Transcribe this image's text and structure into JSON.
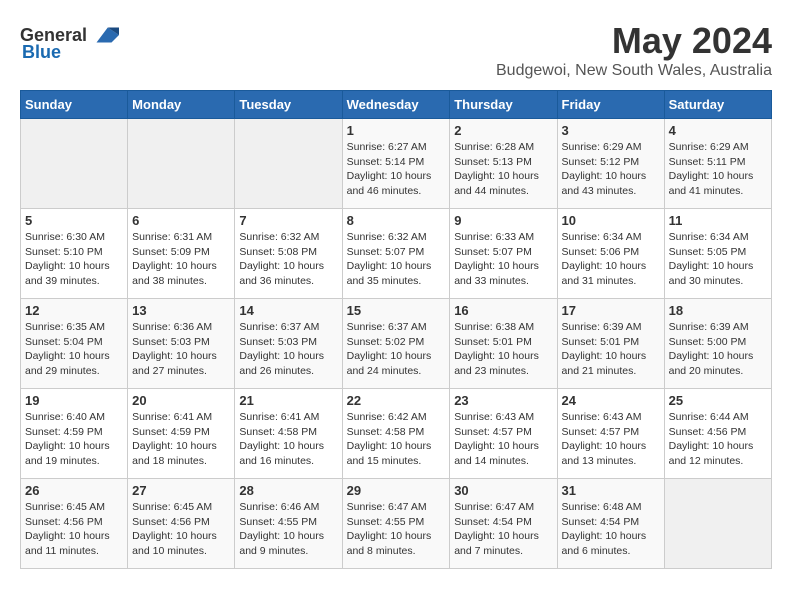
{
  "header": {
    "logo_general": "General",
    "logo_blue": "Blue",
    "month": "May 2024",
    "location": "Budgewoi, New South Wales, Australia"
  },
  "days_of_week": [
    "Sunday",
    "Monday",
    "Tuesday",
    "Wednesday",
    "Thursday",
    "Friday",
    "Saturday"
  ],
  "weeks": [
    [
      {
        "day": "",
        "info": ""
      },
      {
        "day": "",
        "info": ""
      },
      {
        "day": "",
        "info": ""
      },
      {
        "day": "1",
        "info": "Sunrise: 6:27 AM\nSunset: 5:14 PM\nDaylight: 10 hours and 46 minutes."
      },
      {
        "day": "2",
        "info": "Sunrise: 6:28 AM\nSunset: 5:13 PM\nDaylight: 10 hours and 44 minutes."
      },
      {
        "day": "3",
        "info": "Sunrise: 6:29 AM\nSunset: 5:12 PM\nDaylight: 10 hours and 43 minutes."
      },
      {
        "day": "4",
        "info": "Sunrise: 6:29 AM\nSunset: 5:11 PM\nDaylight: 10 hours and 41 minutes."
      }
    ],
    [
      {
        "day": "5",
        "info": "Sunrise: 6:30 AM\nSunset: 5:10 PM\nDaylight: 10 hours and 39 minutes."
      },
      {
        "day": "6",
        "info": "Sunrise: 6:31 AM\nSunset: 5:09 PM\nDaylight: 10 hours and 38 minutes."
      },
      {
        "day": "7",
        "info": "Sunrise: 6:32 AM\nSunset: 5:08 PM\nDaylight: 10 hours and 36 minutes."
      },
      {
        "day": "8",
        "info": "Sunrise: 6:32 AM\nSunset: 5:07 PM\nDaylight: 10 hours and 35 minutes."
      },
      {
        "day": "9",
        "info": "Sunrise: 6:33 AM\nSunset: 5:07 PM\nDaylight: 10 hours and 33 minutes."
      },
      {
        "day": "10",
        "info": "Sunrise: 6:34 AM\nSunset: 5:06 PM\nDaylight: 10 hours and 31 minutes."
      },
      {
        "day": "11",
        "info": "Sunrise: 6:34 AM\nSunset: 5:05 PM\nDaylight: 10 hours and 30 minutes."
      }
    ],
    [
      {
        "day": "12",
        "info": "Sunrise: 6:35 AM\nSunset: 5:04 PM\nDaylight: 10 hours and 29 minutes."
      },
      {
        "day": "13",
        "info": "Sunrise: 6:36 AM\nSunset: 5:03 PM\nDaylight: 10 hours and 27 minutes."
      },
      {
        "day": "14",
        "info": "Sunrise: 6:37 AM\nSunset: 5:03 PM\nDaylight: 10 hours and 26 minutes."
      },
      {
        "day": "15",
        "info": "Sunrise: 6:37 AM\nSunset: 5:02 PM\nDaylight: 10 hours and 24 minutes."
      },
      {
        "day": "16",
        "info": "Sunrise: 6:38 AM\nSunset: 5:01 PM\nDaylight: 10 hours and 23 minutes."
      },
      {
        "day": "17",
        "info": "Sunrise: 6:39 AM\nSunset: 5:01 PM\nDaylight: 10 hours and 21 minutes."
      },
      {
        "day": "18",
        "info": "Sunrise: 6:39 AM\nSunset: 5:00 PM\nDaylight: 10 hours and 20 minutes."
      }
    ],
    [
      {
        "day": "19",
        "info": "Sunrise: 6:40 AM\nSunset: 4:59 PM\nDaylight: 10 hours and 19 minutes."
      },
      {
        "day": "20",
        "info": "Sunrise: 6:41 AM\nSunset: 4:59 PM\nDaylight: 10 hours and 18 minutes."
      },
      {
        "day": "21",
        "info": "Sunrise: 6:41 AM\nSunset: 4:58 PM\nDaylight: 10 hours and 16 minutes."
      },
      {
        "day": "22",
        "info": "Sunrise: 6:42 AM\nSunset: 4:58 PM\nDaylight: 10 hours and 15 minutes."
      },
      {
        "day": "23",
        "info": "Sunrise: 6:43 AM\nSunset: 4:57 PM\nDaylight: 10 hours and 14 minutes."
      },
      {
        "day": "24",
        "info": "Sunrise: 6:43 AM\nSunset: 4:57 PM\nDaylight: 10 hours and 13 minutes."
      },
      {
        "day": "25",
        "info": "Sunrise: 6:44 AM\nSunset: 4:56 PM\nDaylight: 10 hours and 12 minutes."
      }
    ],
    [
      {
        "day": "26",
        "info": "Sunrise: 6:45 AM\nSunset: 4:56 PM\nDaylight: 10 hours and 11 minutes."
      },
      {
        "day": "27",
        "info": "Sunrise: 6:45 AM\nSunset: 4:56 PM\nDaylight: 10 hours and 10 minutes."
      },
      {
        "day": "28",
        "info": "Sunrise: 6:46 AM\nSunset: 4:55 PM\nDaylight: 10 hours and 9 minutes."
      },
      {
        "day": "29",
        "info": "Sunrise: 6:47 AM\nSunset: 4:55 PM\nDaylight: 10 hours and 8 minutes."
      },
      {
        "day": "30",
        "info": "Sunrise: 6:47 AM\nSunset: 4:54 PM\nDaylight: 10 hours and 7 minutes."
      },
      {
        "day": "31",
        "info": "Sunrise: 6:48 AM\nSunset: 4:54 PM\nDaylight: 10 hours and 6 minutes."
      },
      {
        "day": "",
        "info": ""
      }
    ]
  ]
}
